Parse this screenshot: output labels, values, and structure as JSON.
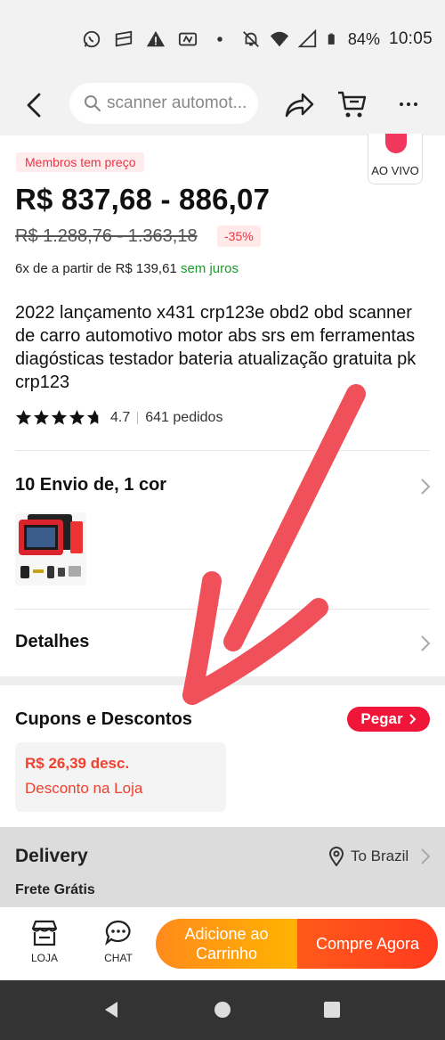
{
  "status_bar": {
    "battery": "84%",
    "time": "10:05"
  },
  "top_bar": {
    "search_placeholder": "scanner automot..."
  },
  "product": {
    "members_badge": "Membros tem preço",
    "live_label": "AO VIVO",
    "price": "R$ 837,68 - 886,07",
    "old_price": "R$ 1.288,76 - 1.363,18",
    "discount": "-35%",
    "installments_prefix": "6x de a partir de R$ 139,61",
    "installments_suffix": "sem juros",
    "title": "2022 lançamento x431 crp123e obd2 obd scanner de carro automotivo motor abs srs em ferramentas diagósticas testador bateria atualização gratuita pk crp123",
    "rating": "4.7",
    "orders": "641 pedidos",
    "rating_stars": 4.7
  },
  "shipping": {
    "label": "10 Envio de, 1 cor"
  },
  "details": {
    "label": "Detalhes"
  },
  "coupons": {
    "title": "Cupons e Descontos",
    "button": "Pegar",
    "amount": "R$ 26,39 desc.",
    "description": "Desconto na Loja"
  },
  "delivery": {
    "title": "Delivery",
    "destination": "To Brazil",
    "free_shipping": "Frete Grátis"
  },
  "bottom_bar": {
    "store_label": "LOJA",
    "chat_label": "CHAT",
    "add_to_cart": "Adicione ao Carrinho",
    "buy_now": "Compre Agora"
  },
  "colors": {
    "accent_red": "#f0163a",
    "price_red": "#f1402e",
    "green": "#1a9c2b",
    "cart_orange": "#ff9a10",
    "buy_orange": "#ff4a1c",
    "annotation_arrow": "#f0505a"
  }
}
